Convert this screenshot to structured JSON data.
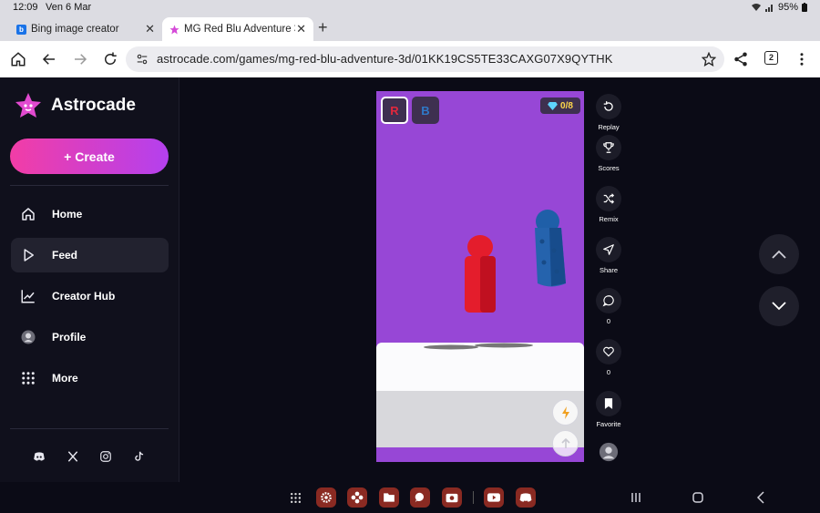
{
  "status_bar": {
    "time": "12:09",
    "date": "Ven 6 Mar",
    "battery": "95%"
  },
  "tabs": [
    {
      "title": "Bing image creator",
      "favicon": "bing-icon"
    },
    {
      "title": "MG Red Blu Adventure 3D",
      "favicon": "astrocade-star-icon",
      "active": true
    }
  ],
  "toolbar": {
    "url": "astrocade.com/games/mg-red-blu-adventure-3d/01KK19CS5TE33CAXG07X9QYTHK",
    "tab_count": "2"
  },
  "sidebar": {
    "brand": "Astrocade",
    "create_label": "+ Create",
    "items": [
      {
        "label": "Home",
        "icon": "home-icon"
      },
      {
        "label": "Feed",
        "icon": "play-icon",
        "active": true
      },
      {
        "label": "Creator Hub",
        "icon": "chart-icon"
      },
      {
        "label": "Profile",
        "icon": "avatar-icon"
      },
      {
        "label": "More",
        "icon": "grid-icon"
      }
    ],
    "socials": [
      "discord-icon",
      "x-icon",
      "instagram-icon",
      "tiktok-icon"
    ]
  },
  "game": {
    "btn_r": "R",
    "btn_b": "B",
    "gems": "0/8",
    "colors": {
      "background": "#9747d6",
      "red_player": "#e41d2c",
      "blue_player": "#1f5fa8"
    }
  },
  "actions": [
    {
      "label": "Replay",
      "icon": "replay-icon"
    },
    {
      "label": "Scores",
      "icon": "trophy-icon"
    },
    {
      "label": "Remix",
      "icon": "shuffle-icon"
    },
    {
      "label": "Share",
      "icon": "send-icon"
    },
    {
      "label": "0",
      "icon": "comment-icon"
    },
    {
      "label": "0",
      "icon": "heart-icon"
    },
    {
      "label": "Favorite",
      "icon": "bookmark-icon"
    }
  ],
  "theme": {
    "accent_start": "#f23da6",
    "accent_end": "#b440ee",
    "bg": "#0b0b16"
  }
}
